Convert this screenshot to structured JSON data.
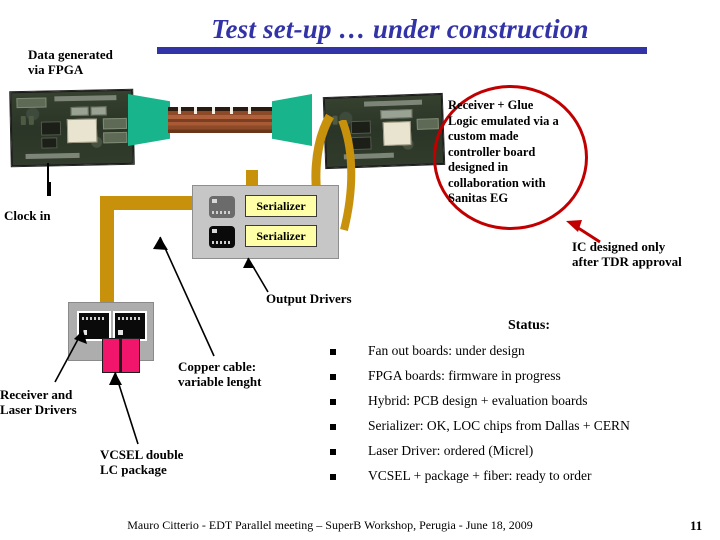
{
  "slide": {
    "title": "Test set-up … under construction",
    "title_color": "#3333A8",
    "footer": "Mauro Citterio - EDT Parallel meeting – SuperB Workshop, Perugia - June 18, 2009",
    "page_number": "11"
  },
  "callouts": {
    "data_generated": "Data generated\nvia FPGA",
    "data_generated_line1": "Data generated",
    "data_generated_line2": "via FPGA",
    "clock_in": "Clock in",
    "output_drivers": "Output Drivers",
    "copper_cable_line1": "Copper cable:",
    "copper_cable_line2": "variable lenght",
    "receiver_laser_line1": "Receiver and",
    "receiver_laser_line2": "Laser Drivers",
    "vcsel_line1": "VCSEL double",
    "vcsel_line2": "LC package",
    "ic_designed_line1": "IC designed only",
    "ic_designed_line2": "after TDR approval"
  },
  "ellipse_callout": {
    "border_color": "#C00000",
    "text": "Receiver + Glue Logic emulated via a custom made controller board designed in collaboration with Sanitas EG"
  },
  "serializer_board": {
    "box1_label": "Serializer",
    "box2_label": "Serializer",
    "box_color": "#FFFFA8"
  },
  "status": {
    "heading": "Status:",
    "items": [
      "Fan out boards: under design",
      "FPGA boards: firmware in progress",
      "Hybrid: PCB design + evaluation boards",
      "Serializer: OK, LOC chips from Dallas + CERN",
      "Laser Driver: ordered (Micrel)",
      "VCSEL + package + fiber: ready to order"
    ]
  },
  "colors": {
    "gold_cable": "#C8910C",
    "green_connector": "#18B58C",
    "vcsel_pink": "#F2156C",
    "board_gray": "#C6C6C6"
  }
}
